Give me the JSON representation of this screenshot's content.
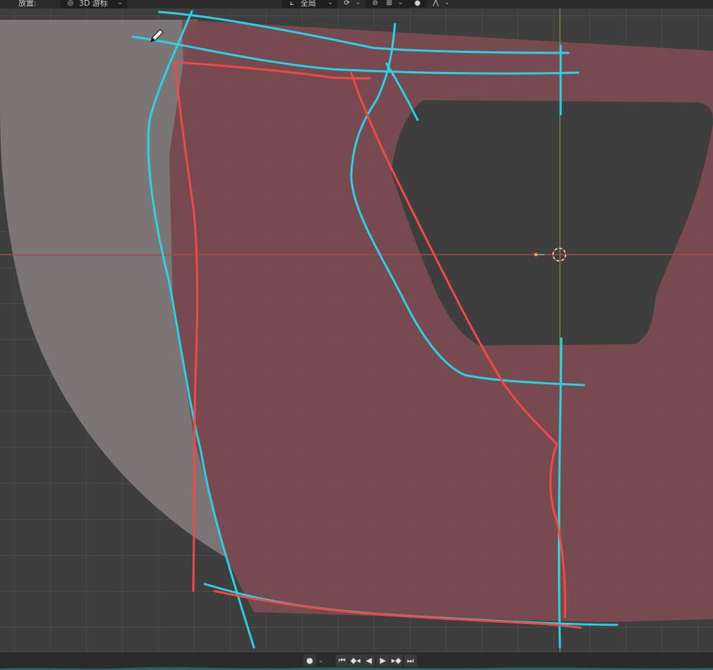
{
  "header": {
    "placement_label": "放置:",
    "cursor_mode": "3D 游标",
    "orientation": "全局",
    "snap_icon": "snap-icon",
    "proportional_icon": "proportional-edit-icon"
  },
  "colors": {
    "viewport_bg": "#3e3e3e",
    "mesh_fill": "#7a4b50",
    "ref_image": "#7b7675",
    "annot_blue": "#2ad2e6",
    "annot_red": "#f04a48",
    "x_axis": "#b8474d",
    "y_axis": "#7a9a3a"
  },
  "timeline": {
    "buttons": [
      "jump-start-icon",
      "prev-keyframe-icon",
      "play-reverse-icon",
      "play-icon",
      "next-keyframe-icon",
      "jump-end-icon"
    ]
  }
}
